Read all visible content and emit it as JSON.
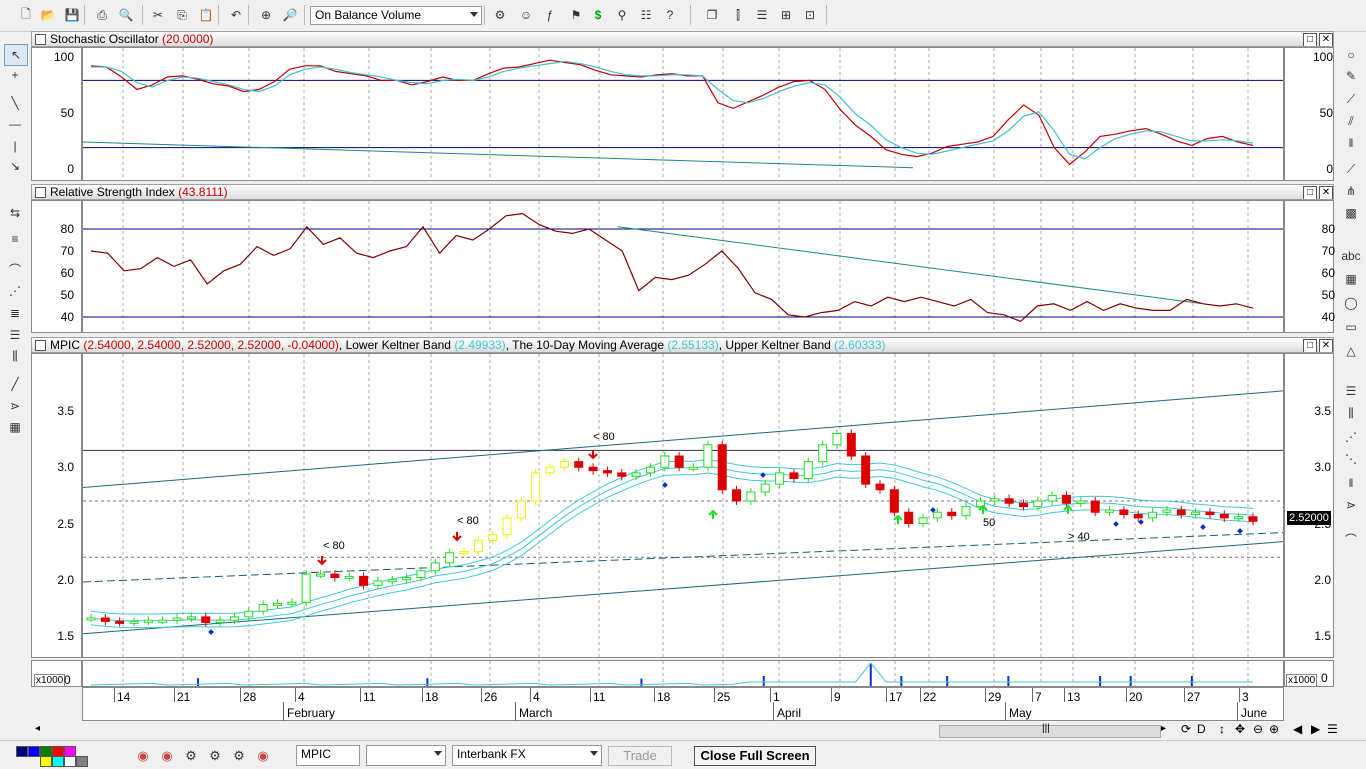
{
  "toolbar": {
    "indicator_select": "On Balance Volume",
    "icons": [
      "new-document-icon",
      "open-folder-icon",
      "save-icon",
      "print-icon",
      "print-preview-icon",
      "cut-icon",
      "copy-icon",
      "paste-icon",
      "undo-icon",
      "crosshair-icon",
      "zoom-icon",
      "indicator-icon",
      "expert-icon",
      "formula-icon",
      "system-tester-icon",
      "dollar-icon",
      "binoculars-icon",
      "scan-icon",
      "help-icon",
      "cascade-icon",
      "tile-vertical-icon",
      "tile-horizontal-icon",
      "tile-grid-icon",
      "arrange-icon"
    ]
  },
  "panels": {
    "stochastic": {
      "title": "Stochastic Oscillator",
      "value": "(20.0000)",
      "yticks": [
        "100",
        "50",
        "0"
      ]
    },
    "rsi": {
      "title": "Relative Strength Index",
      "value": "(43.8111)",
      "yticks": [
        "80",
        "70",
        "60",
        "50",
        "40"
      ]
    },
    "price": {
      "symbol": "MPIC",
      "ohlc": "(2.54000, 2.54000, 2.52000, 2.52000, -0.04000)",
      "lower_label": "Lower Keltner Band",
      "lower_value": "(2.49933)",
      "ma_label": "The 10-Day Moving Average",
      "ma_value": "(2.55133)",
      "upper_label": "Upper Keltner Band",
      "upper_value": "(2.60333)",
      "yticks": [
        "3.5",
        "3.0",
        "2.5",
        "2.0",
        "1.5"
      ],
      "last_price": "2.52000",
      "annotations": [
        "< 80",
        "< 80",
        "< 80",
        "50",
        "> 40"
      ]
    },
    "volume": {
      "multiplier": "x1000",
      "zero": "0"
    }
  },
  "date_axis": {
    "days": [
      "14",
      "21",
      "28",
      "4",
      "11",
      "18",
      "26",
      "4",
      "11",
      "18",
      "25",
      "1",
      "9",
      "17",
      "22",
      "29",
      "7",
      "13",
      "20",
      "27",
      "3"
    ],
    "months": [
      "February",
      "March",
      "April",
      "May",
      "June"
    ]
  },
  "statusbar": {
    "symbol": "MPIC",
    "exchange": "Interbank FX",
    "trade_label": "Trade",
    "fullscreen_label": "Close Full Screen",
    "colors": [
      "#000080",
      "#0000ff",
      "#008000",
      "#ff0000",
      "#ff00ff",
      "#ffff00",
      "#00ffff",
      "#ffffff",
      "#808080"
    ]
  },
  "colors": {
    "stoch_k": "#c00000",
    "stoch_d": "#40c0d0",
    "rsi": "#800000",
    "trend": "#1a8a7a",
    "level": "#000080",
    "bull": "#22dd22",
    "bear": "#dd0000",
    "yellow": "#f0f000",
    "band": "#40c8d8"
  },
  "chart_data": [
    {
      "type": "line",
      "title": "Stochastic Oscillator",
      "ylim": [
        0,
        100
      ],
      "series": [
        {
          "values": [
            93,
            92,
            83,
            72,
            76,
            83,
            84,
            81,
            77,
            75,
            70,
            72,
            79,
            90,
            93,
            93,
            88,
            86,
            84,
            80,
            80,
            76,
            79,
            83,
            80,
            80,
            86,
            91,
            92,
            95,
            98,
            96,
            94,
            89,
            85,
            84,
            83,
            85,
            86,
            84,
            84,
            60,
            55,
            61,
            67,
            74,
            79,
            80,
            72,
            54,
            40,
            30,
            18,
            14,
            12,
            15,
            21,
            23,
            25,
            30,
            45,
            58,
            49,
            20,
            5,
            16,
            30,
            32,
            35,
            37,
            32,
            26,
            22,
            28,
            30,
            25,
            22
          ]
        },
        {
          "values": [
            92,
            92,
            88,
            78,
            74,
            80,
            83,
            82,
            79,
            76,
            72,
            70,
            75,
            85,
            90,
            92,
            90,
            87,
            85,
            83,
            80,
            78,
            77,
            80,
            81,
            80,
            83,
            88,
            91,
            93,
            95,
            97,
            95,
            92,
            88,
            85,
            84,
            84,
            85,
            85,
            84,
            72,
            62,
            60,
            64,
            70,
            75,
            78,
            76,
            65,
            50,
            40,
            27,
            20,
            15,
            14,
            17,
            20,
            23,
            26,
            35,
            48,
            52,
            35,
            14,
            10,
            20,
            28,
            32,
            35,
            34,
            30,
            26,
            26,
            27,
            26,
            24
          ]
        }
      ]
    },
    {
      "type": "line",
      "title": "Relative Strength Index",
      "ylim": [
        35,
        88
      ],
      "series": [
        {
          "values": [
            70,
            69,
            61,
            62,
            67,
            63,
            66,
            55,
            61,
            64,
            72,
            68,
            71,
            81,
            73,
            76,
            69,
            67,
            70,
            72,
            81,
            69,
            77,
            75,
            80,
            86,
            87,
            82,
            79,
            78,
            80,
            75,
            70,
            52,
            58,
            57,
            59,
            64,
            70,
            62,
            51,
            48,
            41,
            40,
            42,
            43,
            47,
            45,
            49,
            47,
            49,
            47,
            45,
            48,
            42,
            41,
            38,
            45,
            46,
            43,
            47,
            43,
            46,
            44,
            43,
            43,
            48,
            46,
            45,
            46,
            44
          ]
        }
      ]
    },
    {
      "type": "candlestick",
      "title": "MPIC",
      "ylim": [
        1.35,
        3.95
      ],
      "series": [
        {
          "name": "Lower Keltner Band",
          "values": [
            2.49933
          ]
        },
        {
          "name": "The 10-Day Moving Average",
          "values": [
            2.55133
          ]
        },
        {
          "name": "Upper Keltner Band",
          "values": [
            2.60333
          ]
        }
      ],
      "close": [
        1.66,
        1.63,
        1.62,
        1.63,
        1.64,
        1.64,
        1.66,
        1.67,
        1.62,
        1.64,
        1.67,
        1.72,
        1.78,
        1.79,
        1.8,
        2.05,
        2.05,
        2.02,
        2.03,
        1.95,
        1.99,
        2.0,
        2.02,
        2.08,
        2.15,
        2.24,
        2.25,
        2.35,
        2.4,
        2.55,
        2.7,
        2.95,
        3.0,
        3.05,
        3.0,
        2.97,
        2.95,
        2.92,
        2.95,
        3.0,
        3.1,
        3.0,
        3.0,
        3.2,
        2.8,
        2.7,
        2.78,
        2.85,
        2.95,
        2.9,
        3.05,
        3.2,
        3.3,
        3.1,
        2.85,
        2.8,
        2.6,
        2.5,
        2.55,
        2.6,
        2.57,
        2.65,
        2.7,
        2.72,
        2.68,
        2.65,
        2.7,
        2.75,
        2.68,
        2.7,
        2.6,
        2.62,
        2.58,
        2.55,
        2.6,
        2.62,
        2.58,
        2.6,
        2.58,
        2.55,
        2.56,
        2.52
      ]
    }
  ]
}
